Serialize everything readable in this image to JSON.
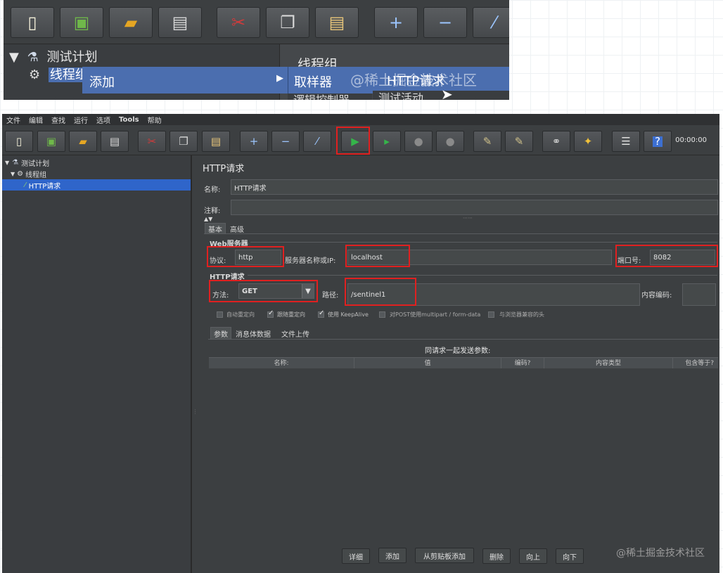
{
  "top_shot": {
    "tree": {
      "root": "测试计划",
      "thread_group": "线程组"
    },
    "right_title": "线程组",
    "menu": {
      "add": "添加",
      "sampler": "取样器",
      "http_request": "HTTP请求",
      "next": "测试活动",
      "cut_item": "逻辑控制器"
    },
    "watermark": "@稀土掘金技术社区"
  },
  "menubar": [
    "文件",
    "编辑",
    "查找",
    "运行",
    "选项",
    "Tools",
    "帮助"
  ],
  "toolbar": {
    "time": "00:00:00"
  },
  "tree": {
    "test_plan": "测试计划",
    "thread_group": "线程组",
    "http_request": "HTTP请求"
  },
  "panel": {
    "title": "HTTP请求",
    "name_label": "名称:",
    "name_value": "HTTP请求",
    "comment_label": "注释:",
    "tabs": {
      "basic": "基本",
      "advanced": "高级"
    },
    "web_server": {
      "legend": "Web服务器",
      "protocol_label": "协议:",
      "protocol_value": "http",
      "server_label": "服务器名称或IP:",
      "server_value": "localhost",
      "port_label": "端口号:",
      "port_value": "8082"
    },
    "http_request": {
      "legend": "HTTP请求",
      "method_label": "方法:",
      "method_value": "GET",
      "path_label": "路径:",
      "path_value": "/sentinel1",
      "encoding_label": "内容编码:"
    },
    "checkboxes": [
      {
        "label": "自动重定向",
        "checked": false
      },
      {
        "label": "跟随重定向",
        "checked": true
      },
      {
        "label": "使用 KeepAlive",
        "checked": true
      },
      {
        "label": "对POST使用multipart / form-data",
        "checked": false
      },
      {
        "label": "与浏览器兼容的头",
        "checked": false
      }
    ],
    "subtabs": {
      "params": "参数",
      "body": "消息体数据",
      "files": "文件上传"
    },
    "params_caption": "同请求一起发送参数:",
    "columns": [
      "名称:",
      "值",
      "编码?",
      "内容类型",
      "包含等于?"
    ],
    "buttons": [
      "详细",
      "添加",
      "从剪贴板添加",
      "删除",
      "向上",
      "向下"
    ]
  },
  "watermark": "@稀土掘金技术社区"
}
